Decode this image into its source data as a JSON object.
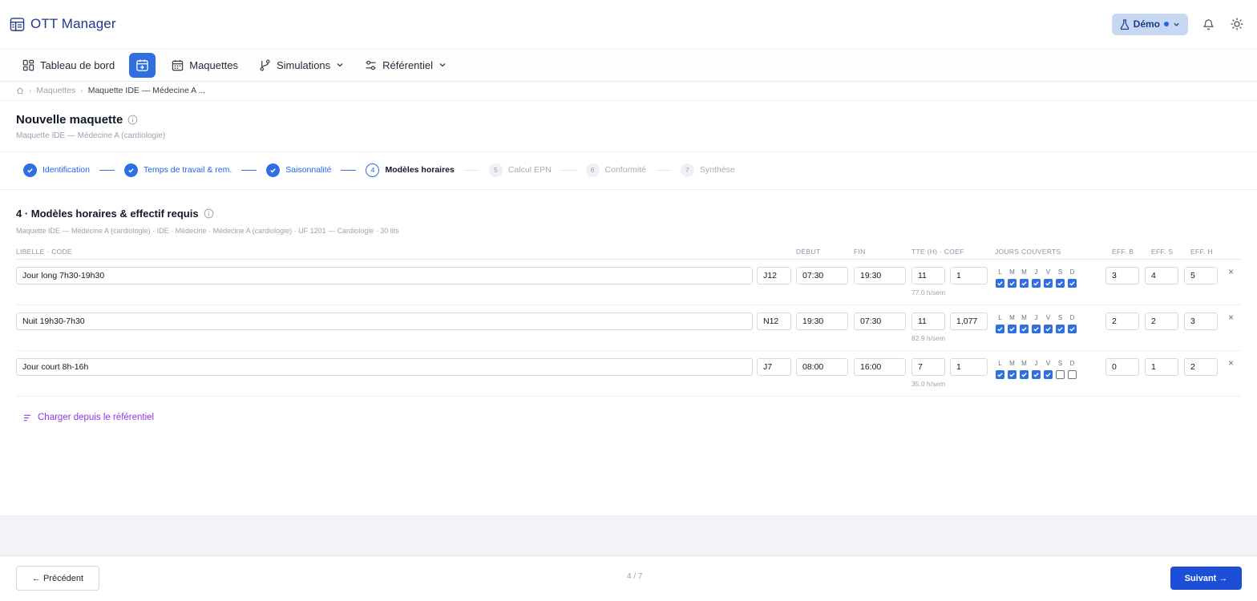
{
  "app": {
    "name": "OTT Manager"
  },
  "header": {
    "demo_label": "Démo",
    "demo_dot_color": "#2563eb"
  },
  "nav": {
    "dashboard": "Tableau de bord",
    "maquettes": "Maquettes",
    "simulations": "Simulations",
    "referentiel": "Référentiel"
  },
  "breadcrumb": {
    "level1": "Maquettes",
    "current": "Maquette IDE — Médecine A ..."
  },
  "page": {
    "title": "Nouvelle maquette",
    "subtitle": "Maquette IDE — Médecine A (cardiologie)"
  },
  "stepper": {
    "steps": [
      {
        "num": "1",
        "label": "Identification",
        "state": "done"
      },
      {
        "num": "2",
        "label": "Temps de travail & rem.",
        "state": "done"
      },
      {
        "num": "3",
        "label": "Saisonnalité",
        "state": "done"
      },
      {
        "num": "4",
        "label": "Modèles horaires",
        "state": "current"
      },
      {
        "num": "5",
        "label": "Calcul EPN",
        "state": "todo"
      },
      {
        "num": "6",
        "label": "Conformité",
        "state": "todo"
      },
      {
        "num": "7",
        "label": "Synthèse",
        "state": "todo"
      }
    ]
  },
  "section": {
    "title": "4 · Modèles horaires & effectif requis",
    "subtitle": "Maquette IDE — Médecine A (cardiologie) · IDE · Médecine · Médecine A (cardiologie) · UF 1201 — Cardiologie · 30 lits"
  },
  "table": {
    "headers": {
      "libelle": "LIBELLE · CODE",
      "debut": "DÉBUT",
      "fin": "FIN",
      "tte": "TTE (H) · COEF",
      "jours": "JOURS COUVERTS",
      "eff_b": "EFF. B",
      "eff_s": "EFF. S",
      "eff_h": "EFF. H"
    },
    "day_letters": [
      "L",
      "M",
      "M",
      "J",
      "V",
      "S",
      "D"
    ],
    "rows": [
      {
        "libelle": "Jour long 7h30-19h30",
        "code": "J12",
        "debut": "07:30",
        "fin": "19:30",
        "tte": "11",
        "coef": "1",
        "hsem": "77.0 h/sem",
        "days": [
          true,
          true,
          true,
          true,
          true,
          true,
          true
        ],
        "eff_b": "3",
        "eff_s": "4",
        "eff_h": "5"
      },
      {
        "libelle": "Nuit 19h30-7h30",
        "code": "N12",
        "debut": "19:30",
        "fin": "07:30",
        "tte": "11",
        "coef": "1,077",
        "hsem": "82.9 h/sem",
        "days": [
          true,
          true,
          true,
          true,
          true,
          true,
          true
        ],
        "eff_b": "2",
        "eff_s": "2",
        "eff_h": "3"
      },
      {
        "libelle": "Jour court 8h-16h",
        "code": "J7",
        "debut": "08:00",
        "fin": "16:00",
        "tte": "7",
        "coef": "1",
        "hsem": "35.0 h/sem",
        "days": [
          true,
          true,
          true,
          true,
          true,
          false,
          false
        ],
        "eff_b": "0",
        "eff_s": "1",
        "eff_h": "2"
      }
    ],
    "remove_label": "×"
  },
  "actions": {
    "load_from_ref": "Charger depuis le référentiel"
  },
  "footer": {
    "prev": "← Précédent",
    "progress": "4 / 7",
    "next": "Suivant →"
  },
  "colors": {
    "primary": "#2f6fe0",
    "accent_purple": "#9333ea",
    "brand": "#1e3a8a"
  }
}
